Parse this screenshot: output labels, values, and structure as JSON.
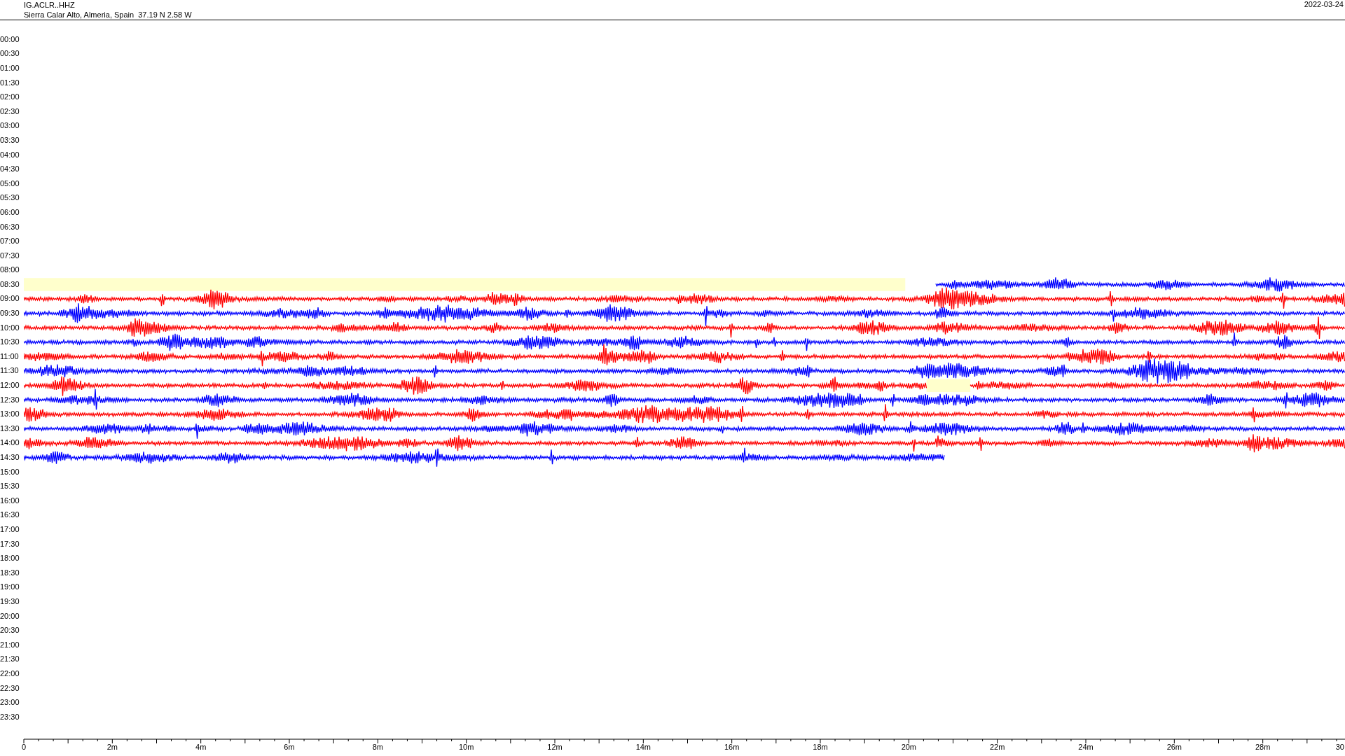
{
  "header": {
    "station": "IG.ACLR..HHZ",
    "location": "Sierra Calar Alto, Almeria, Spain  37.19 N 2.58 W",
    "date": "2022-03-24"
  },
  "rows": [
    {
      "label": "00:00"
    },
    {
      "label": "00:30"
    },
    {
      "label": "01:00"
    },
    {
      "label": "01:30"
    },
    {
      "label": "02:00"
    },
    {
      "label": "02:30"
    },
    {
      "label": "03:00"
    },
    {
      "label": "03:30"
    },
    {
      "label": "04:00"
    },
    {
      "label": "04:30"
    },
    {
      "label": "05:00"
    },
    {
      "label": "05:30"
    },
    {
      "label": "06:00"
    },
    {
      "label": "06:30"
    },
    {
      "label": "07:00"
    },
    {
      "label": "07:30"
    },
    {
      "label": "08:00"
    },
    {
      "label": "08:30",
      "trace": {
        "kind": "late-start",
        "color": "#0000ff",
        "level": 0.687
      }
    },
    {
      "label": "09:00",
      "trace": {
        "kind": "full",
        "color": "#ff0000"
      }
    },
    {
      "label": "09:30",
      "trace": {
        "kind": "full",
        "color": "#0000ff"
      }
    },
    {
      "label": "10:00",
      "trace": {
        "kind": "full",
        "color": "#ff0000"
      }
    },
    {
      "label": "10:30",
      "trace": {
        "kind": "full",
        "color": "#0000ff"
      }
    },
    {
      "label": "11:00",
      "trace": {
        "kind": "full",
        "color": "#ff0000"
      }
    },
    {
      "label": "11:30",
      "trace": {
        "kind": "full",
        "color": "#0000ff"
      }
    },
    {
      "label": "12:00",
      "trace": {
        "kind": "gap",
        "color": "#ff0000",
        "level": 0.68
      }
    },
    {
      "label": "12:30",
      "trace": {
        "kind": "full",
        "color": "#0000ff"
      }
    },
    {
      "label": "13:00",
      "trace": {
        "kind": "full",
        "color": "#ff0000"
      }
    },
    {
      "label": "13:30",
      "trace": {
        "kind": "full",
        "color": "#0000ff"
      }
    },
    {
      "label": "14:00",
      "trace": {
        "kind": "full",
        "color": "#ff0000"
      }
    },
    {
      "label": "14:30",
      "trace": {
        "kind": "ends-early",
        "color": "#0000ff",
        "level": 0.694
      }
    },
    {
      "label": "15:00"
    },
    {
      "label": "15:30"
    },
    {
      "label": "16:00"
    },
    {
      "label": "16:30"
    },
    {
      "label": "17:00"
    },
    {
      "label": "17:30"
    },
    {
      "label": "18:00"
    },
    {
      "label": "18:30"
    },
    {
      "label": "19:00"
    },
    {
      "label": "19:30"
    },
    {
      "label": "20:00"
    },
    {
      "label": "20:30"
    },
    {
      "label": "21:00"
    },
    {
      "label": "21:30"
    },
    {
      "label": "22:00"
    },
    {
      "label": "22:30"
    },
    {
      "label": "23:00"
    },
    {
      "label": "23:30"
    }
  ],
  "axis": {
    "labels": [
      "0",
      "2m",
      "4m",
      "6m",
      "8m",
      "10m",
      "12m",
      "14m",
      "16m",
      "18m",
      "20m",
      "22m",
      "24m",
      "26m",
      "28m",
      "30"
    ]
  }
}
